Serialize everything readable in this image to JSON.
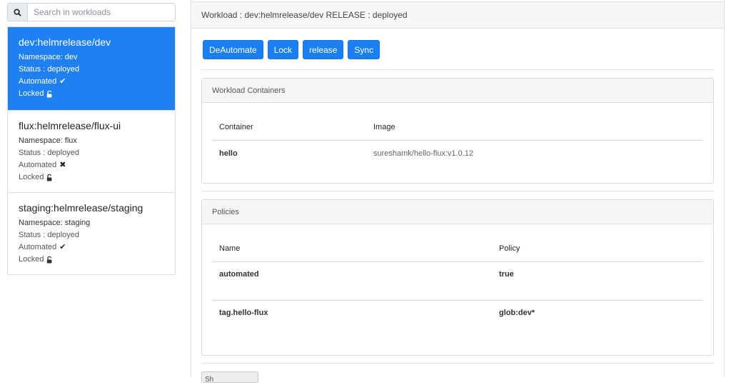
{
  "search": {
    "placeholder": "Search in workloads",
    "icon": "search-icon"
  },
  "workloads": [
    {
      "title": "dev:helmrelease/dev",
      "namespace": "Namespace: dev",
      "status": "Status : deployed",
      "automated_label": "Automated",
      "automated_glyph": "✔",
      "locked_label": "Locked"
    },
    {
      "title": "flux:helmrelease/flux-ui",
      "namespace": "Namespace: flux",
      "status": "Status : deployed",
      "automated_label": "Automated",
      "automated_glyph": "✖",
      "locked_label": "Locked"
    },
    {
      "title": "staging:helmrelease/staging",
      "namespace": "Namespace: staging",
      "status": "Status : deployed",
      "automated_label": "Automated",
      "automated_glyph": "✔",
      "locked_label": "Locked"
    }
  ],
  "main": {
    "header": "Workload : dev:helmrelease/dev RELEASE : deployed",
    "buttons": {
      "deautomate": "DeAutomate",
      "lock": "Lock",
      "release": "release",
      "sync": "Sync"
    },
    "containers": {
      "title": "Workload Containers",
      "columns": [
        "Container",
        "Image"
      ],
      "rows": [
        {
          "container": "hello",
          "image": "sureshamk/hello-flux:v1.0.12"
        }
      ]
    },
    "policies": {
      "title": "Policies",
      "columns": [
        "Name",
        "Policy"
      ],
      "rows": [
        {
          "name": "automated",
          "policy": "true"
        },
        {
          "name": "tag.hello-flux",
          "policy": "glob:dev*"
        }
      ]
    },
    "bottom_button_label": "Sh"
  },
  "colors": {
    "accent": "#1f80f3",
    "button": "#1a7ff2",
    "header_bg": "#f7f7f7"
  }
}
